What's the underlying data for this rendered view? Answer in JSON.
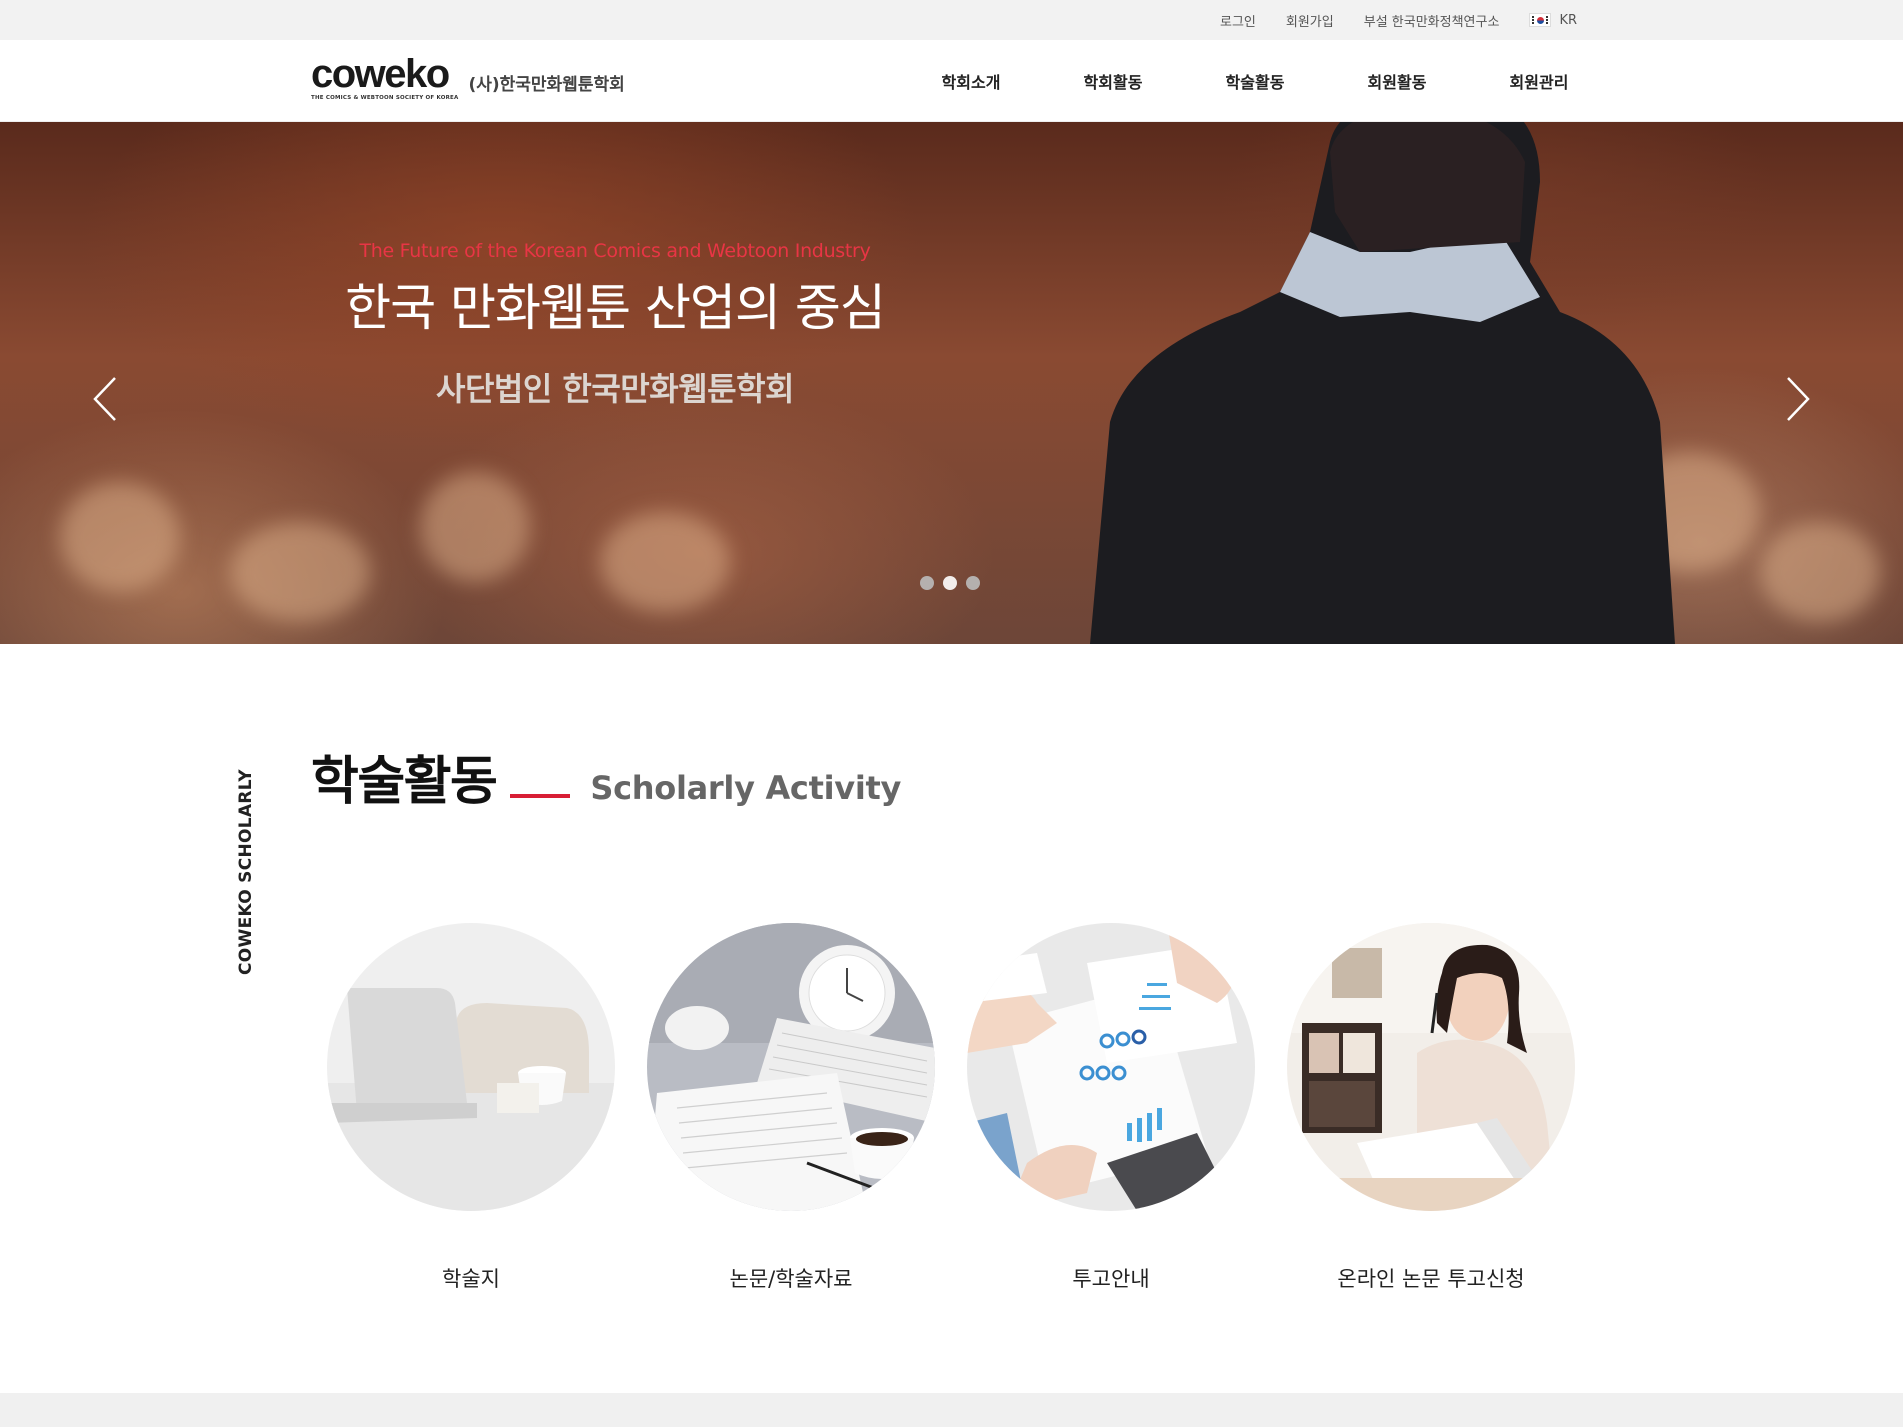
{
  "topbar": {
    "login": "로그인",
    "signup": "회원가입",
    "institute": "부설 한국만화정책연구소",
    "lang": "KR"
  },
  "header": {
    "logo_word": "coweko",
    "logo_sub": "THE COMICS & WEBTOON SOCIETY OF KOREA",
    "logo_kr": "(사)한국만화웹툰학회",
    "nav": [
      "학회소개",
      "학회활동",
      "학술활동",
      "회원활동",
      "회원관리"
    ]
  },
  "hero": {
    "eyebrow": "The Future of the Korean Comics and Webtoon Industry",
    "title": "한국 만화웹툰 산업의 중심",
    "subtitle": "사단법인 한국만화웹툰학회",
    "slide_count": 3,
    "active_slide": 2
  },
  "section": {
    "side_label": "COWEKO SCHOLARLY",
    "title_kr": "학술활동",
    "title_en": "Scholarly Activity",
    "accent_color": "#d81e35",
    "cards": [
      {
        "label": "학술지"
      },
      {
        "label": "논문/학술자료"
      },
      {
        "label": "투고안내"
      },
      {
        "label": "온라인 논문 투고신청"
      }
    ]
  }
}
